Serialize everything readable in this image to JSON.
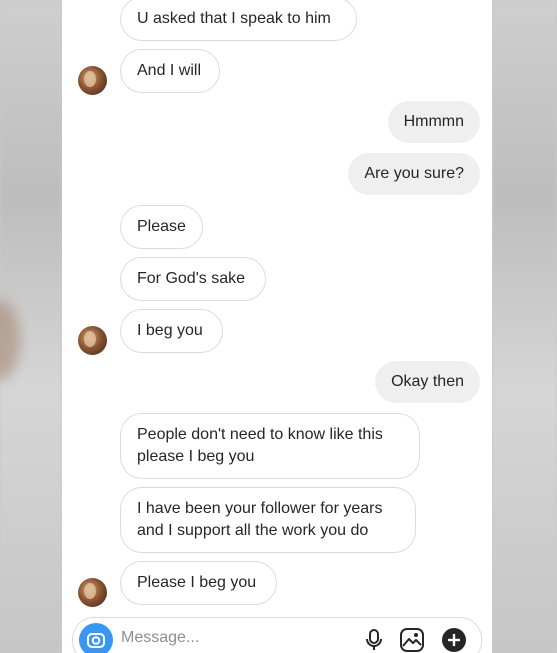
{
  "messages": [
    {
      "side": "in",
      "text": "U asked that I speak to him",
      "avatar": false
    },
    {
      "side": "in",
      "text": "And I will",
      "avatar": true
    },
    {
      "side": "out",
      "text": "Hmmmn"
    },
    {
      "side": "out",
      "text": "Are you sure?"
    },
    {
      "side": "in",
      "text": "Please",
      "avatar": false
    },
    {
      "side": "in",
      "text": "For God's sake",
      "avatar": false
    },
    {
      "side": "in",
      "text": "I beg you",
      "avatar": true
    },
    {
      "side": "out",
      "text": "Okay then"
    },
    {
      "side": "in",
      "text": "People don't need to know like this please I beg you",
      "avatar": false
    },
    {
      "side": "in",
      "text": "I have been your follower for years and I support all the work you do",
      "avatar": false
    },
    {
      "side": "in",
      "text": "Please I beg you",
      "avatar": true
    }
  ],
  "composer": {
    "placeholder": "Message...",
    "icons": [
      "camera-icon",
      "microphone-icon",
      "gallery-icon",
      "add-icon"
    ]
  },
  "colors": {
    "camera_button": "#3897f0",
    "outgoing_bubble": "#efefef",
    "incoming_border": "#dbdbdb",
    "text": "#262626"
  }
}
